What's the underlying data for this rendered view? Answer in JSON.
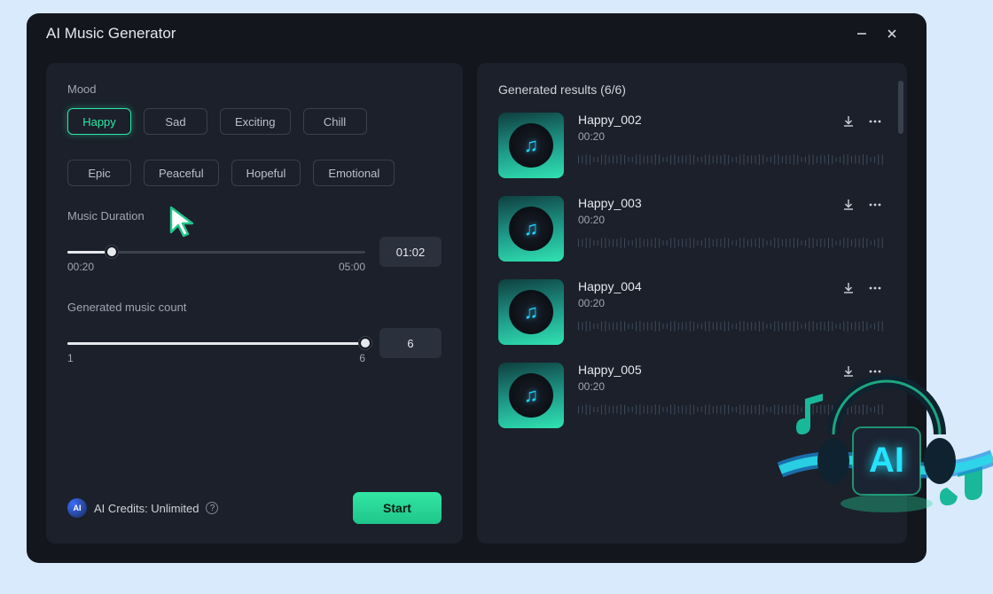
{
  "window": {
    "title": "AI Music Generator"
  },
  "mood": {
    "label": "Mood",
    "options": [
      "Happy",
      "Sad",
      "Exciting",
      "Chill",
      "Epic",
      "Peaceful",
      "Hopeful",
      "Emotional"
    ],
    "selected_index": 0
  },
  "duration": {
    "label": "Music Duration",
    "min_label": "00:20",
    "max_label": "05:00",
    "value_label": "01:02",
    "fill_percent": 15
  },
  "count": {
    "label": "Generated music count",
    "min_label": "1",
    "max_label": "6",
    "value_label": "6",
    "fill_percent": 100
  },
  "credits": {
    "badge_text": "AI",
    "label": "AI Credits: Unlimited"
  },
  "start": {
    "label": "Start"
  },
  "results": {
    "header": "Generated results (6/6)",
    "items": [
      {
        "title": "Happy_002",
        "time": "00:20"
      },
      {
        "title": "Happy_003",
        "time": "00:20"
      },
      {
        "title": "Happy_004",
        "time": "00:20"
      },
      {
        "title": "Happy_005",
        "time": "00:20"
      }
    ]
  }
}
